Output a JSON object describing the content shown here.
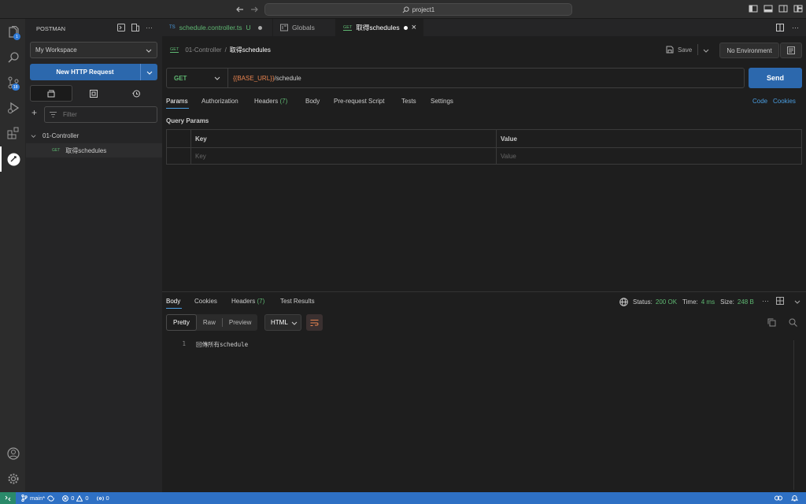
{
  "window": {
    "search_text": "project1"
  },
  "activity": {
    "source_control_badge": "18",
    "explorer_badge": "1"
  },
  "sidebar": {
    "title": "POSTMAN",
    "workspace": "My Workspace",
    "new_request_label": "New HTTP Request",
    "filter_placeholder": "Filter",
    "collection_name": "01-Controller",
    "request_method": "GET",
    "request_name": "取得schedules"
  },
  "tabs": [
    {
      "prefix": "TS",
      "label": "schedule.controller.ts",
      "status": "U"
    },
    {
      "label": "Globals"
    },
    {
      "label": "取得schedules"
    }
  ],
  "request": {
    "breadcrumb_parent": "01-Controller",
    "breadcrumb_sep": "/",
    "breadcrumb_current": "取得schedules",
    "save_label": "Save",
    "environment": "No Environment",
    "method": "GET",
    "url_variable": "{{BASE_URL}}",
    "url_path": "/schedule",
    "send_label": "Send",
    "tabs": {
      "params": "Params",
      "authorization": "Authorization",
      "headers": "Headers",
      "headers_count": "(7)",
      "body": "Body",
      "prerequest": "Pre-request Script",
      "tests": "Tests",
      "settings": "Settings"
    },
    "code_link": "Code",
    "cookies_link": "Cookies",
    "query_params_title": "Query Params",
    "table": {
      "key_header": "Key",
      "value_header": "Value",
      "key_placeholder": "Key",
      "value_placeholder": "Value"
    }
  },
  "response": {
    "tabs": {
      "body": "Body",
      "cookies": "Cookies",
      "headers": "Headers",
      "headers_count": "(7)",
      "test_results": "Test Results"
    },
    "status_label": "Status:",
    "status_value": "200 OK",
    "time_label": "Time:",
    "time_value": "4 ms",
    "size_label": "Size:",
    "size_value": "248 B",
    "views": {
      "pretty": "Pretty",
      "raw": "Raw",
      "preview": "Preview"
    },
    "format": "HTML",
    "line_number": "1",
    "body_text": "回傳所有schedule"
  },
  "statusbar": {
    "branch": "main*",
    "errors": "0",
    "warnings": "0",
    "ports": "0"
  },
  "colors": {
    "accent": "#2c68ad",
    "status_ok": "#5fb872",
    "method_get": "#5fb872",
    "variable": "#e8834f",
    "statusbar": "#2e70c4"
  }
}
